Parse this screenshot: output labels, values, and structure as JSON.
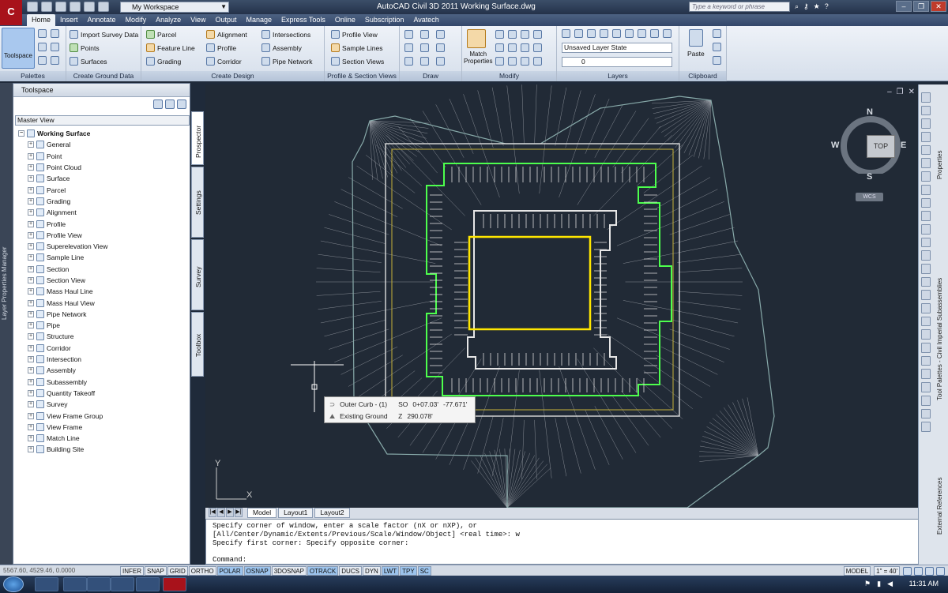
{
  "titlebar": {
    "app_title": "AutoCAD Civil 3D 2011    Working Surface.dwg",
    "workspace": "My Workspace",
    "search_placeholder": "Type a keyword or phrase",
    "logo": "C"
  },
  "tabs": [
    "Home",
    "Insert",
    "Annotate",
    "Modify",
    "Analyze",
    "View",
    "Output",
    "Manage",
    "Express Tools",
    "Online",
    "Subscription",
    "Avatech"
  ],
  "ribbon": {
    "toolspace_label": "Toolspace",
    "palettes_title": "Palettes",
    "create_ground": {
      "title": "Create Ground Data",
      "items": [
        "Import Survey Data",
        "Points",
        "Surfaces"
      ]
    },
    "create_design": {
      "title": "Create Design",
      "col1": [
        "Parcel",
        "Feature Line",
        "Grading"
      ],
      "col2": [
        "Alignment",
        "Profile",
        "Corridor"
      ],
      "col3": [
        "Intersections",
        "Assembly",
        "Pipe Network"
      ]
    },
    "profile_section": {
      "title": "Profile & Section Views",
      "items": [
        "Profile View",
        "Sample Lines",
        "Section Views"
      ]
    },
    "draw": {
      "title": "Draw"
    },
    "modify": {
      "title": "Modify",
      "match_label": "Match Properties"
    },
    "layers": {
      "title": "Layers",
      "layer_state": "Unsaved Layer State",
      "current_layer": "0"
    },
    "clipboard": {
      "title": "Clipboard",
      "paste_label": "Paste"
    }
  },
  "left_strip": {
    "label": "Layer Properties Manager"
  },
  "toolspace": {
    "header": "Toolspace",
    "view_select": "Master View",
    "root": "Working Surface",
    "items": [
      "General",
      "Point",
      "Point Cloud",
      "Surface",
      "Parcel",
      "Grading",
      "Alignment",
      "Profile",
      "Profile View",
      "Superelevation View",
      "Sample Line",
      "Section",
      "Section View",
      "Mass Haul Line",
      "Mass Haul View",
      "Pipe Network",
      "Pipe",
      "Structure",
      "Corridor",
      "Intersection",
      "Assembly",
      "Subassembly",
      "Quantity Takeoff",
      "Survey",
      "View Frame Group",
      "View Frame",
      "Match Line",
      "Building Site"
    ],
    "vtabs": [
      "Prospector",
      "Settings",
      "Survey",
      "Toolbox"
    ]
  },
  "viewcube": {
    "n": "N",
    "s": "S",
    "e": "E",
    "w": "W",
    "top": "TOP",
    "wcs": "WCS"
  },
  "tooltip": {
    "row1_name": "Outer Curb - (1)",
    "row1_key": "SO",
    "row1_station": "0+07.03'",
    "row1_value": "-77.671'",
    "row2_name": "Existing Ground",
    "row2_key": "Z",
    "row2_value": "290.078'"
  },
  "ucs": {
    "x": "X",
    "y": "Y"
  },
  "layout_tabs": [
    "Model",
    "Layout1",
    "Layout2"
  ],
  "command": {
    "line1": "Specify corner of window, enter a scale factor (nX or nXP), or",
    "line2": "[All/Center/Dynamic/Extents/Previous/Scale/Window/Object] <real time>: w",
    "line3": "Specify first corner: Specify opposite corner:",
    "prompt": "Command:"
  },
  "status": {
    "coords": "5567.60, 4529.46, 0.0000",
    "toggles": [
      "INFER",
      "SNAP",
      "GRID",
      "ORTHO",
      "POLAR",
      "OSNAP",
      "3DOSNAP",
      "OTRACK",
      "DUCS",
      "DYN",
      "LWT",
      "TPY",
      "SC"
    ],
    "on_toggles": [
      "POLAR",
      "OSNAP",
      "OTRACK",
      "LWT",
      "TPY",
      "SC"
    ],
    "model": "MODEL",
    "scale": "1\" = 40'"
  },
  "right_palette": {
    "properties": "Properties",
    "tool_palettes": "Tool Palettes - Civil Imperial Subassemblies",
    "xref": "External References"
  },
  "taskbar": {
    "clock": "11:31 AM"
  },
  "colors": {
    "canvas_bg": "#212a36",
    "curb_green": "#4dff4d",
    "building_yellow": "#ffe600",
    "ribbon_bg": "#dfe7f1"
  }
}
